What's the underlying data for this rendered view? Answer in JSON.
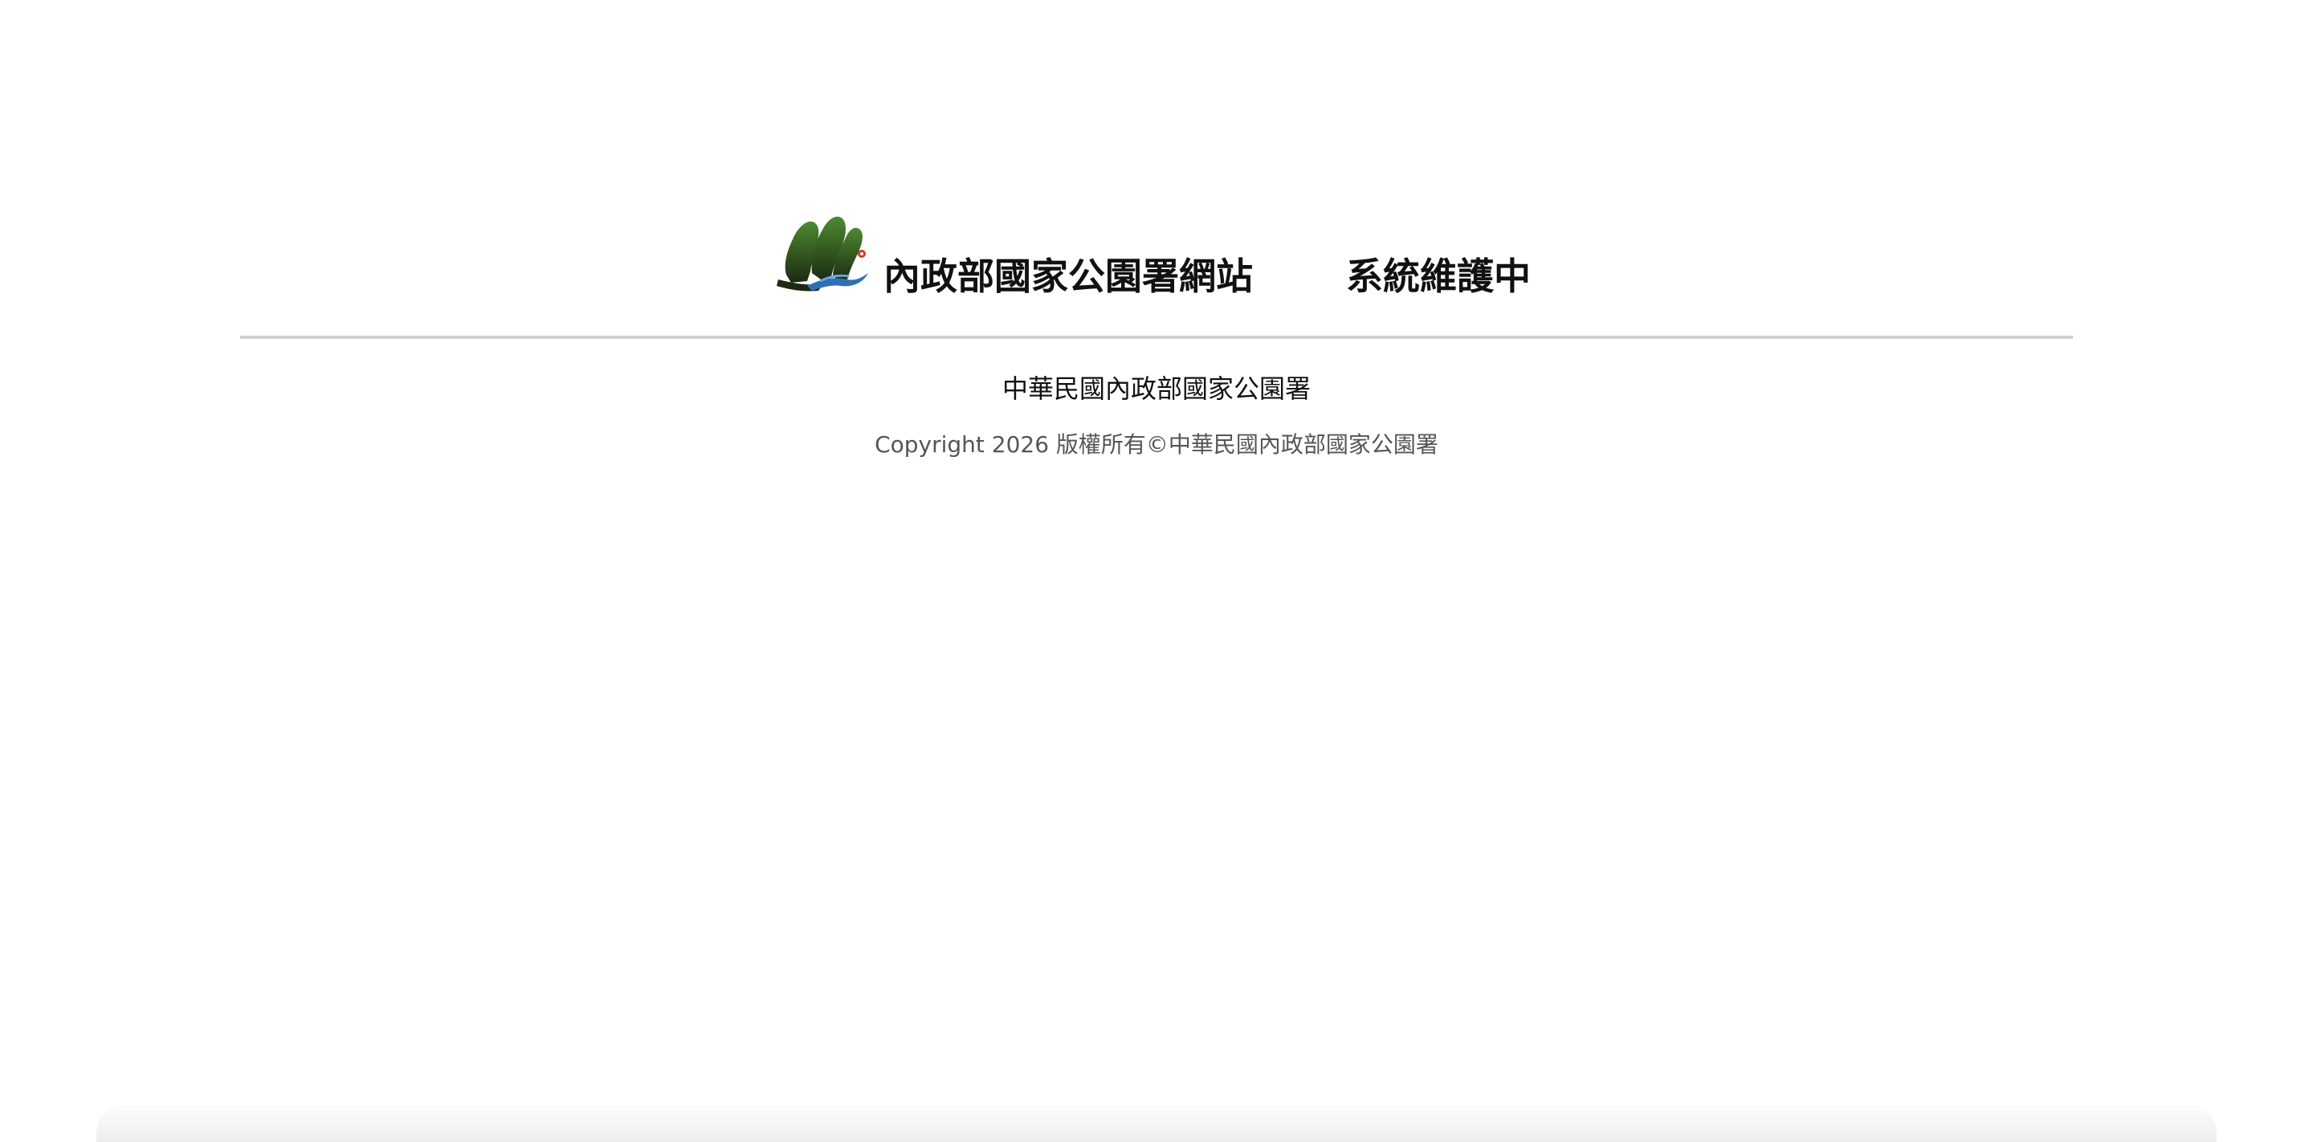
{
  "header": {
    "logo_icon": "national-park-logo-icon",
    "site_title": "內政部國家公園署網站",
    "status_text": "系統維護中"
  },
  "footer": {
    "organization": "中華民國內政部國家公園署",
    "copyright": "Copyright 2026 版權所有©中華民國內政部國家公園署"
  },
  "colors": {
    "logo_green": "#3f7a2b",
    "logo_dark": "#1d2a12",
    "logo_blue": "#2f6fb3",
    "logo_red": "#d23a2a",
    "divider": "#cfcfcf"
  }
}
